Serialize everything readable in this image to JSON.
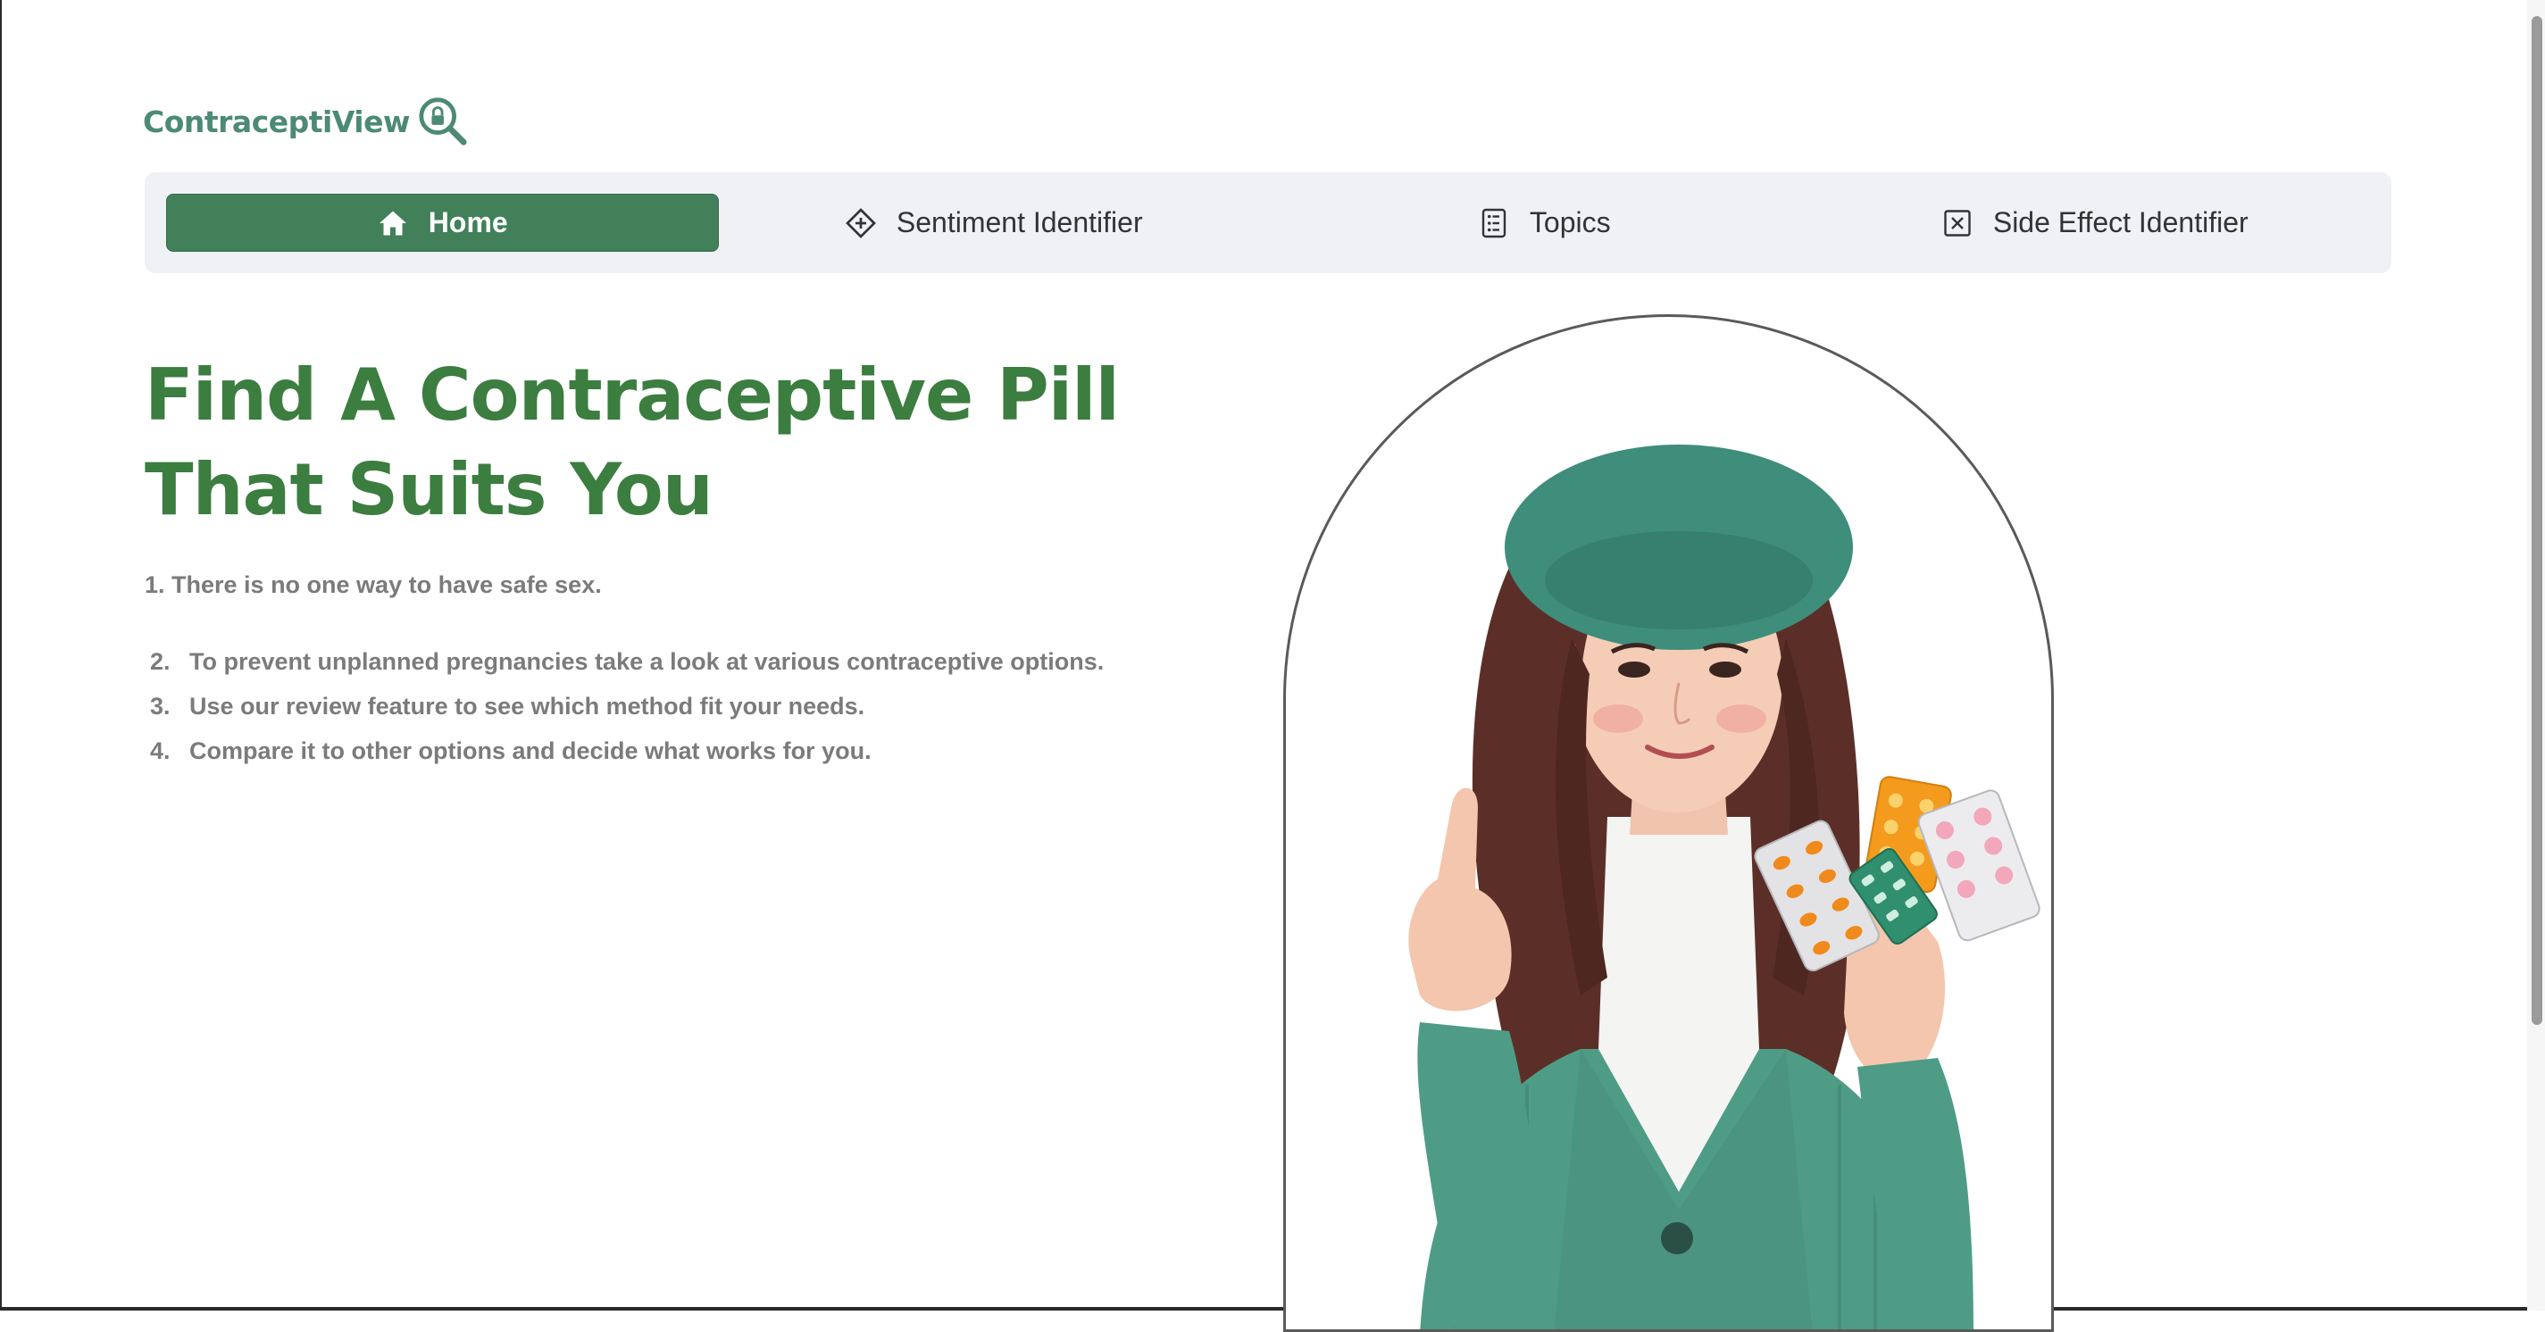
{
  "brand": {
    "name": "ContraceptiView",
    "icon": "magnifier-lock-icon",
    "color": "#4c8a76"
  },
  "nav": {
    "items": [
      {
        "label": "Home",
        "icon": "home-icon",
        "active": true
      },
      {
        "label": "Sentiment Identifier",
        "icon": "diamond-plus-icon",
        "active": false
      },
      {
        "label": "Topics",
        "icon": "list-icon",
        "active": false
      },
      {
        "label": "Side Effect Identifier",
        "icon": "x-square-icon",
        "active": false
      }
    ],
    "active_color": "#418058"
  },
  "hero": {
    "title": "Find A Contraceptive Pill That Suits You",
    "title_color": "#3c7d40",
    "intro": "1. There is no one way to have safe sex.",
    "steps": [
      {
        "num": "2.",
        "text": "To prevent unplanned pregnancies take a look at various contraceptive options."
      },
      {
        "num": "3.",
        "text": "Use our review feature to see which method fit your needs."
      },
      {
        "num": "4.",
        "text": "Compare it to other options and decide what works for you."
      }
    ]
  },
  "image": {
    "subject": "woman-holding-pills-illustration"
  }
}
